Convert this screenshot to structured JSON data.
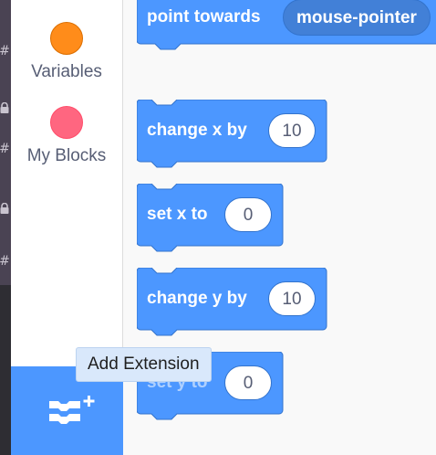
{
  "colors": {
    "motion_blue": "#4c97ff",
    "variables_orange": "#ff8c1a",
    "my_blocks_pink": "#ff6680"
  },
  "sidebar_strip": {
    "glyphs": [
      "#",
      "lock-icon",
      "#",
      "lock-icon",
      "#"
    ]
  },
  "categories": [
    {
      "label": "Variables",
      "color": "#ff8c1a"
    },
    {
      "label": "My Blocks",
      "color": "#ff6680"
    }
  ],
  "extension": {
    "tooltip": "Add Extension",
    "icon": "add-extension-icon"
  },
  "blocks": {
    "point_towards": {
      "label": "point towards",
      "dropdown": "mouse-pointer"
    },
    "change_x": {
      "label": "change x by",
      "value": "10"
    },
    "set_x": {
      "label": "set x to",
      "value": "0"
    },
    "change_y": {
      "label": "change y by",
      "value": "10"
    },
    "set_y": {
      "label": "set y to",
      "value": "0"
    }
  }
}
